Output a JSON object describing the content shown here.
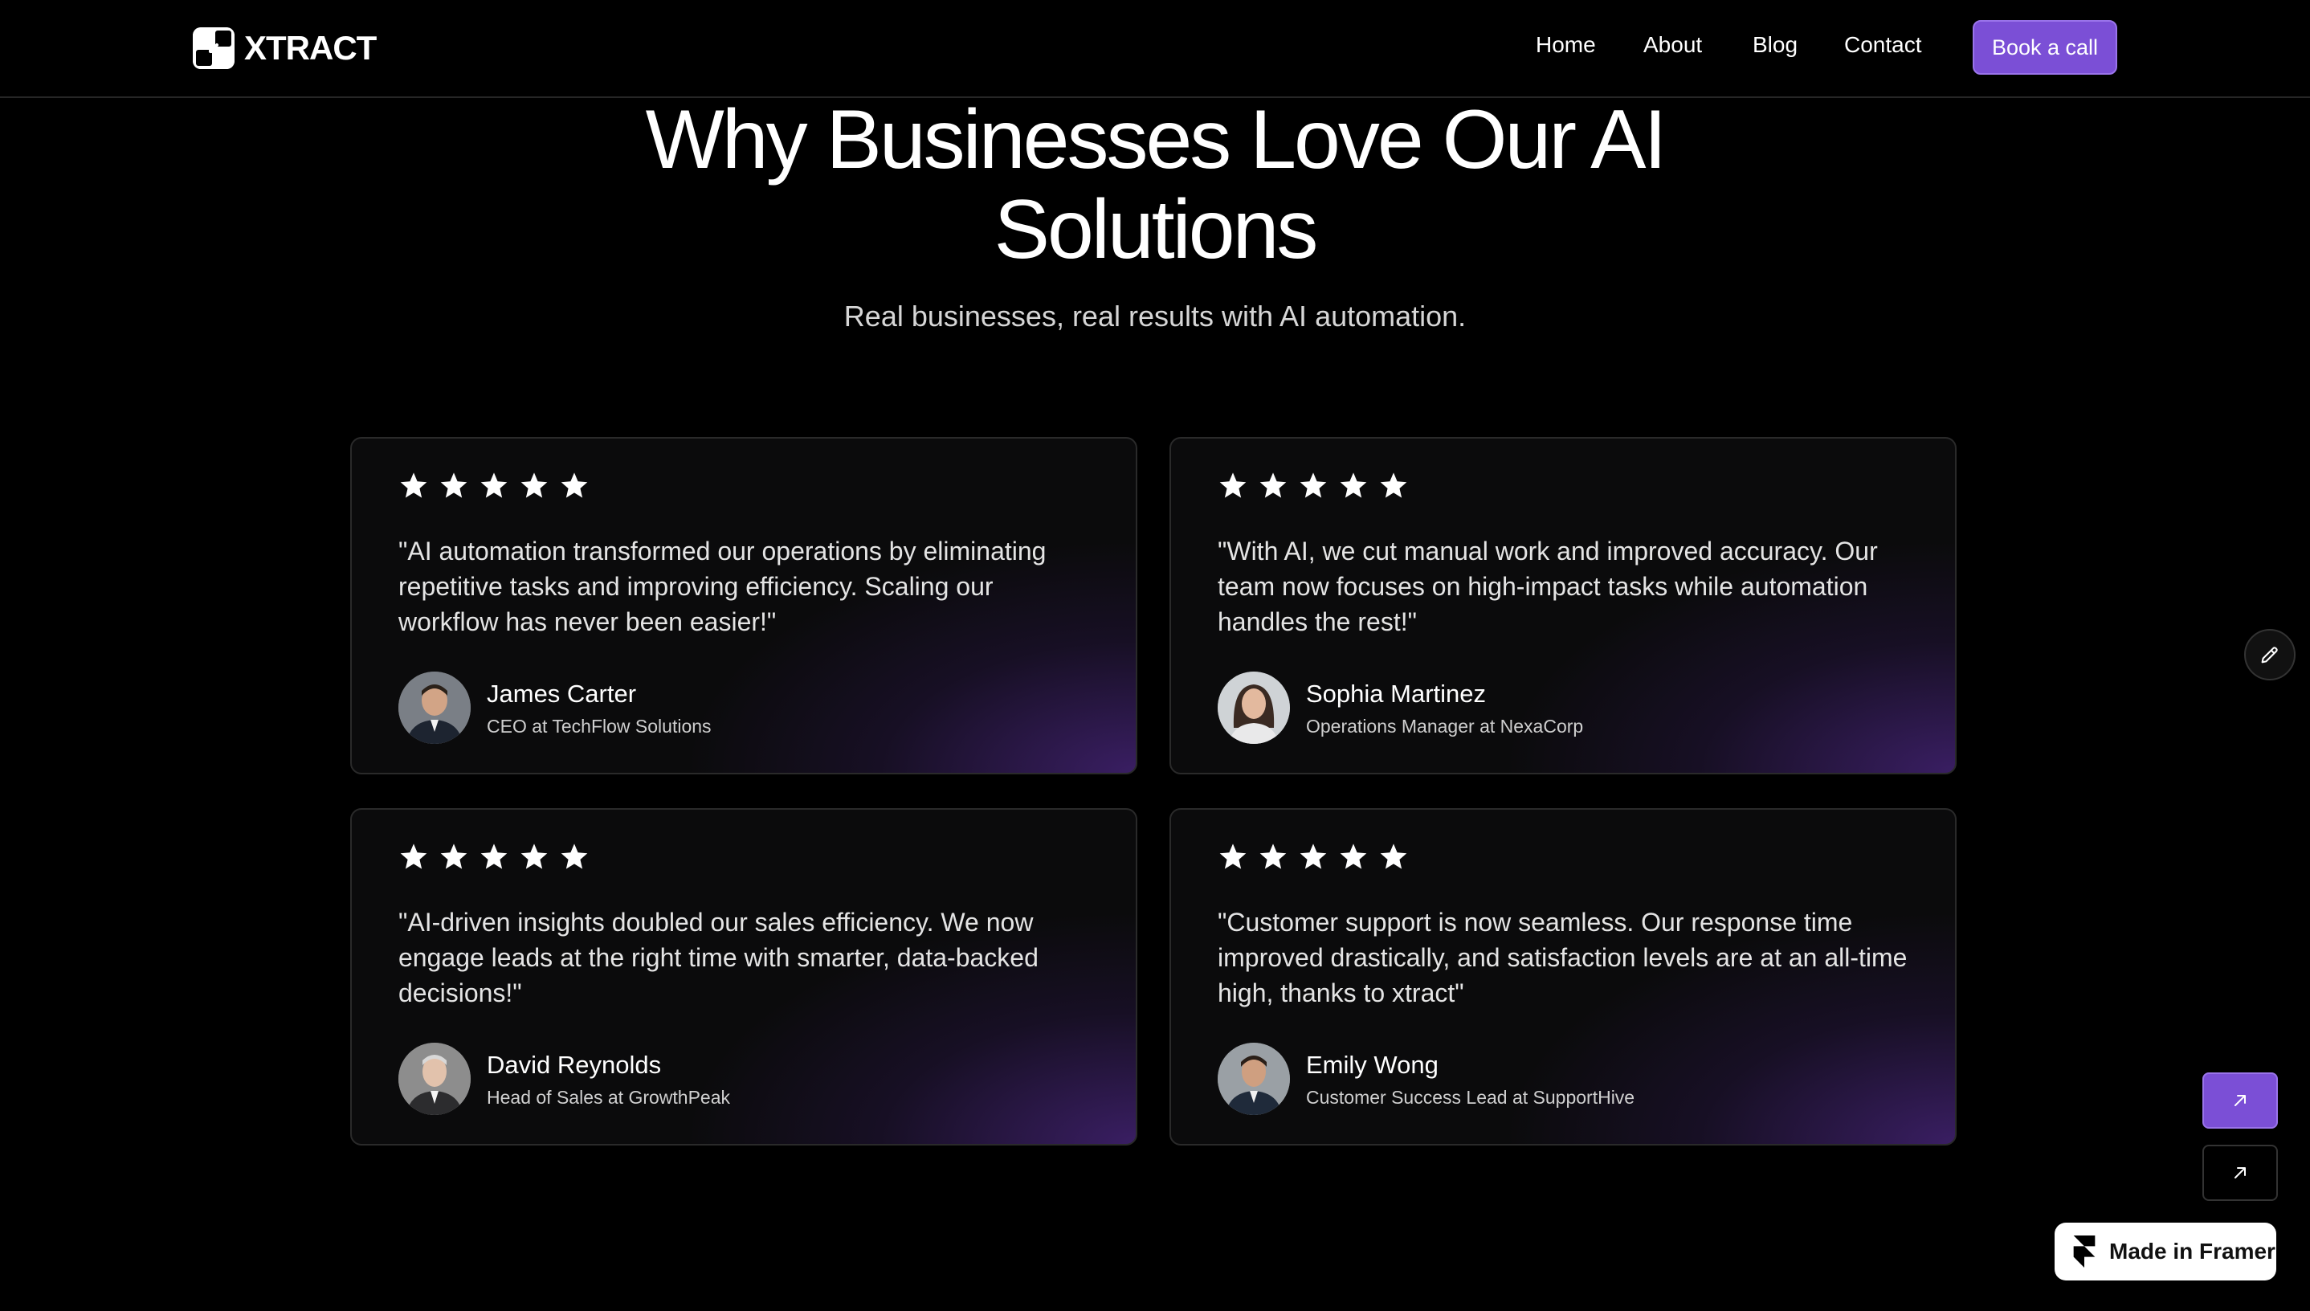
{
  "header": {
    "logo_text": "XTRACT",
    "logo_icon": "xtract-logo-icon",
    "nav": [
      "Home",
      "About",
      "Blog",
      "Contact"
    ],
    "cta_label": "Book a call"
  },
  "hero": {
    "title_line1": "Why Businesses Love Our AI",
    "title_line2": "Solutions",
    "subtitle": "Real businesses, real results with AI automation."
  },
  "testimonials": [
    {
      "rating": 5,
      "quote": "\"AI automation transformed our operations by eliminating repetitive tasks and improving efficiency. Scaling our workflow has never been easier!\"",
      "name": "James Carter",
      "role": "CEO at TechFlow Solutions"
    },
    {
      "rating": 5,
      "quote": "\"With AI, we cut manual work and improved accuracy. Our team now focuses on high-impact tasks while automation handles the rest!\"",
      "name": "Sophia Martinez",
      "role": "Operations Manager at NexaCorp"
    },
    {
      "rating": 5,
      "quote": "\"AI-driven insights doubled our sales efficiency. We now engage leads at the right time with smarter, data-backed decisions!\"",
      "name": "David Reynolds",
      "role": "Head of Sales at GrowthPeak"
    },
    {
      "rating": 5,
      "quote": "\"Customer support is now seamless. Our response time improved drastically, and satisfaction levels are at an all-time high, thanks to xtract\"",
      "name": "Emily Wong",
      "role": "Customer Success Lead at SupportHive"
    }
  ],
  "floating": {
    "edit_icon": "pencil-icon",
    "primary_icon": "arrow-up-right-icon",
    "secondary_icon": "arrow-up-right-icon",
    "framer_badge": "Made in Framer"
  },
  "colors": {
    "accent": "#7b4fd6",
    "background": "#000000",
    "card_glow": "#602eaa"
  }
}
